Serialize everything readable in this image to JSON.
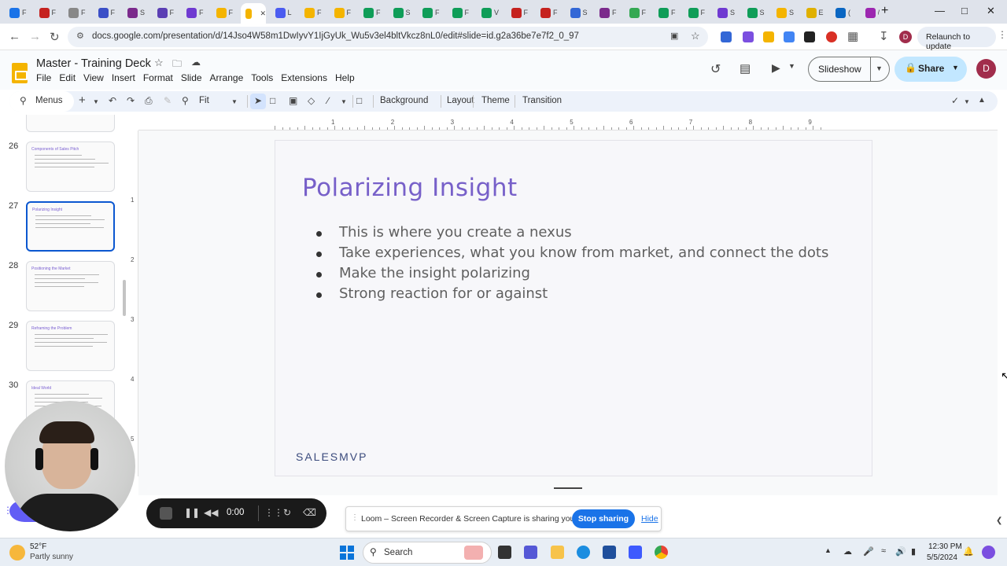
{
  "browser": {
    "tabs": [
      {
        "label": "F",
        "color": "#1a73e8"
      },
      {
        "label": "F",
        "color": "#c5221f"
      },
      {
        "label": "F",
        "color": "#888888"
      },
      {
        "label": "F",
        "color": "#3b4fc7"
      },
      {
        "label": "S",
        "color": "#7b2a8c"
      },
      {
        "label": "F",
        "color": "#5b3fb4"
      },
      {
        "label": "F",
        "color": "#6f3ad1"
      },
      {
        "label": "F",
        "color": "#f4b400"
      },
      {
        "label": "",
        "color": "#f4b400"
      },
      {
        "label": "L",
        "color": "#4b5cf0"
      },
      {
        "label": "F",
        "color": "#f4b400"
      },
      {
        "label": "F",
        "color": "#f4b400"
      },
      {
        "label": "F",
        "color": "#0f9d58"
      },
      {
        "label": "S",
        "color": "#0f9d58"
      },
      {
        "label": "F",
        "color": "#0f9d58"
      },
      {
        "label": "F",
        "color": "#0f9d58"
      },
      {
        "label": "V",
        "color": "#0f9d58"
      },
      {
        "label": "F",
        "color": "#c5221f"
      },
      {
        "label": "F",
        "color": "#c5221f"
      },
      {
        "label": "S",
        "color": "#3367d6"
      },
      {
        "label": "F",
        "color": "#7b2a8c"
      },
      {
        "label": "F",
        "color": "#34a853"
      },
      {
        "label": "F",
        "color": "#0f9d58"
      },
      {
        "label": "F",
        "color": "#0f9d58"
      },
      {
        "label": "S",
        "color": "#6f3ad1"
      },
      {
        "label": "S",
        "color": "#0f9d58"
      },
      {
        "label": "S",
        "color": "#f4b400"
      },
      {
        "label": "E",
        "color": "#e0b000"
      },
      {
        "label": "(",
        "color": "#0a66c2"
      },
      {
        "label": "/",
        "color": "#9c27b0"
      }
    ],
    "url": "docs.google.com/presentation/d/14Jso4W58m1DwIyvY1IjGyUk_Wu5v3el4bltVkcz8nL0/edit#slide=id.g2a36be7e7f2_0_97",
    "relaunch_label": "Relaunch to update",
    "profile_letter": "D"
  },
  "docs": {
    "title": "Master - Training Deck",
    "menus": [
      "File",
      "Edit",
      "View",
      "Insert",
      "Format",
      "Slide",
      "Arrange",
      "Tools",
      "Extensions",
      "Help"
    ],
    "slideshow_label": "Slideshow",
    "share_label": "Share",
    "user_letter": "D"
  },
  "toolbar": {
    "menus_label": "Menus",
    "zoom_label": "Fit",
    "background_label": "Background",
    "layout_label": "Layout",
    "theme_label": "Theme",
    "transition_label": "Transition"
  },
  "filmstrip": {
    "slides": [
      {
        "number": "26",
        "title": "Components of Sales Pitch",
        "active": false
      },
      {
        "number": "27",
        "title": "Polarizing Insight",
        "active": true
      },
      {
        "number": "28",
        "title": "Positioning the Market",
        "active": false
      },
      {
        "number": "29",
        "title": "Reframing the Problem",
        "active": false
      },
      {
        "number": "30",
        "title": "Ideal World",
        "active": false
      }
    ]
  },
  "rulers": {
    "horizontal": [
      "1",
      "2",
      "3",
      "4",
      "5",
      "6",
      "7",
      "8",
      "9"
    ],
    "vertical": [
      "1",
      "2",
      "3",
      "4",
      "5"
    ]
  },
  "slide": {
    "title": "Polarizing Insight",
    "bullets": [
      "This is where you create a nexus",
      "Take experiences, what you know from market, and connect the dots",
      "Make the insight polarizing",
      "Strong reaction for or against"
    ],
    "logo_text": "SALESMVP"
  },
  "loom": {
    "time": "0:00",
    "banner_text": "Loom – Screen Recorder & Screen Capture is sharing your screen.",
    "stop_label": "Stop sharing",
    "hide_label": "Hide"
  },
  "taskbar": {
    "temperature": "52°F",
    "weather": "Partly sunny",
    "search_label": "Search",
    "time": "12:30 PM",
    "date": "5/5/2024"
  },
  "colors": {
    "accent": "#0b57d0",
    "slide_title": "#7760c9",
    "share_button": "#c2e7ff",
    "loom_blue": "#1a73e8"
  }
}
